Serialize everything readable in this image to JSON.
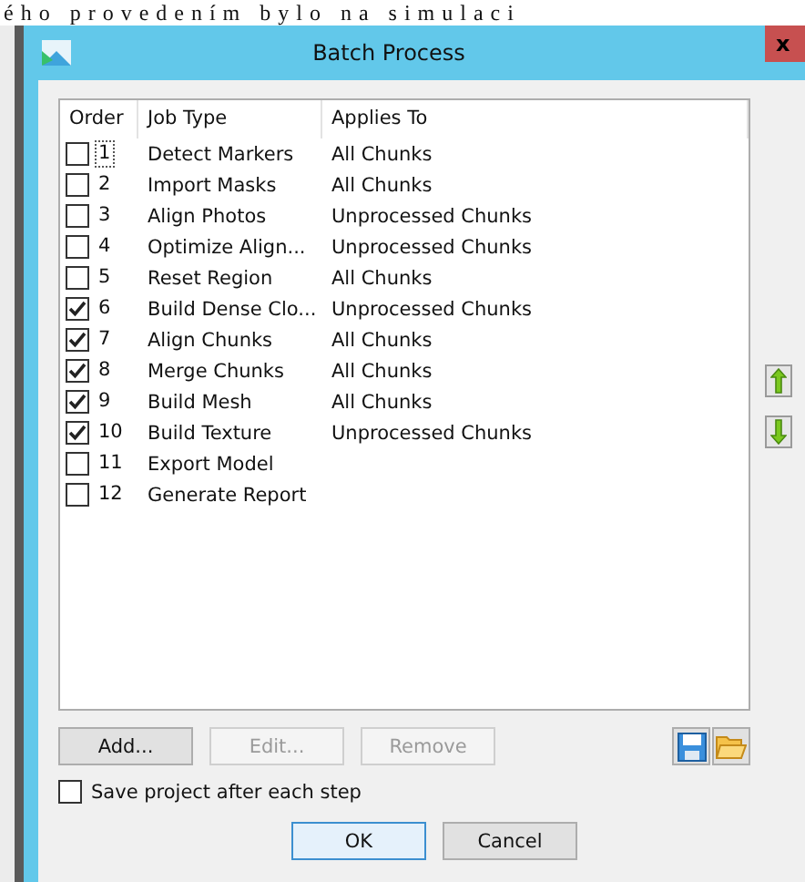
{
  "background_text": "ého provedením bylo na simulaci",
  "window": {
    "title": "Batch Process",
    "close": "x"
  },
  "table": {
    "columns": [
      "Order",
      "Job Type",
      "Applies To"
    ],
    "rows": [
      {
        "order": "1",
        "job_type": "Detect Markers",
        "applies_to": "All Chunks",
        "checked": false,
        "focused": true
      },
      {
        "order": "2",
        "job_type": "Import Masks",
        "applies_to": "All Chunks",
        "checked": false,
        "focused": false
      },
      {
        "order": "3",
        "job_type": "Align Photos",
        "applies_to": "Unprocessed Chunks",
        "checked": false,
        "focused": false
      },
      {
        "order": "4",
        "job_type": "Optimize Align...",
        "applies_to": "Unprocessed Chunks",
        "checked": false,
        "focused": false
      },
      {
        "order": "5",
        "job_type": "Reset Region",
        "applies_to": "All Chunks",
        "checked": false,
        "focused": false
      },
      {
        "order": "6",
        "job_type": "Build Dense Clo...",
        "applies_to": "Unprocessed Chunks",
        "checked": true,
        "focused": false
      },
      {
        "order": "7",
        "job_type": "Align Chunks",
        "applies_to": "All Chunks",
        "checked": true,
        "focused": false
      },
      {
        "order": "8",
        "job_type": "Merge Chunks",
        "applies_to": "All Chunks",
        "checked": true,
        "focused": false
      },
      {
        "order": "9",
        "job_type": "Build Mesh",
        "applies_to": "All Chunks",
        "checked": true,
        "focused": false
      },
      {
        "order": "10",
        "job_type": "Build Texture",
        "applies_to": "Unprocessed Chunks",
        "checked": true,
        "focused": false
      },
      {
        "order": "11",
        "job_type": "Export Model",
        "checked": false,
        "focused": false
      },
      {
        "order": "12",
        "job_type": "Generate Report",
        "checked": false,
        "focused": false
      }
    ]
  },
  "buttons": [
    {
      "label": "Add...",
      "disabled": false
    },
    {
      "label": "Edit...",
      "disabled": true
    },
    {
      "label": "Remove",
      "disabled": true
    }
  ],
  "save_option": {
    "label": "Save project after each step",
    "checked": false
  },
  "dialog_buttons": [
    {
      "label": "OK",
      "default": true
    },
    {
      "label": "Cancel",
      "default": false
    }
  ]
}
